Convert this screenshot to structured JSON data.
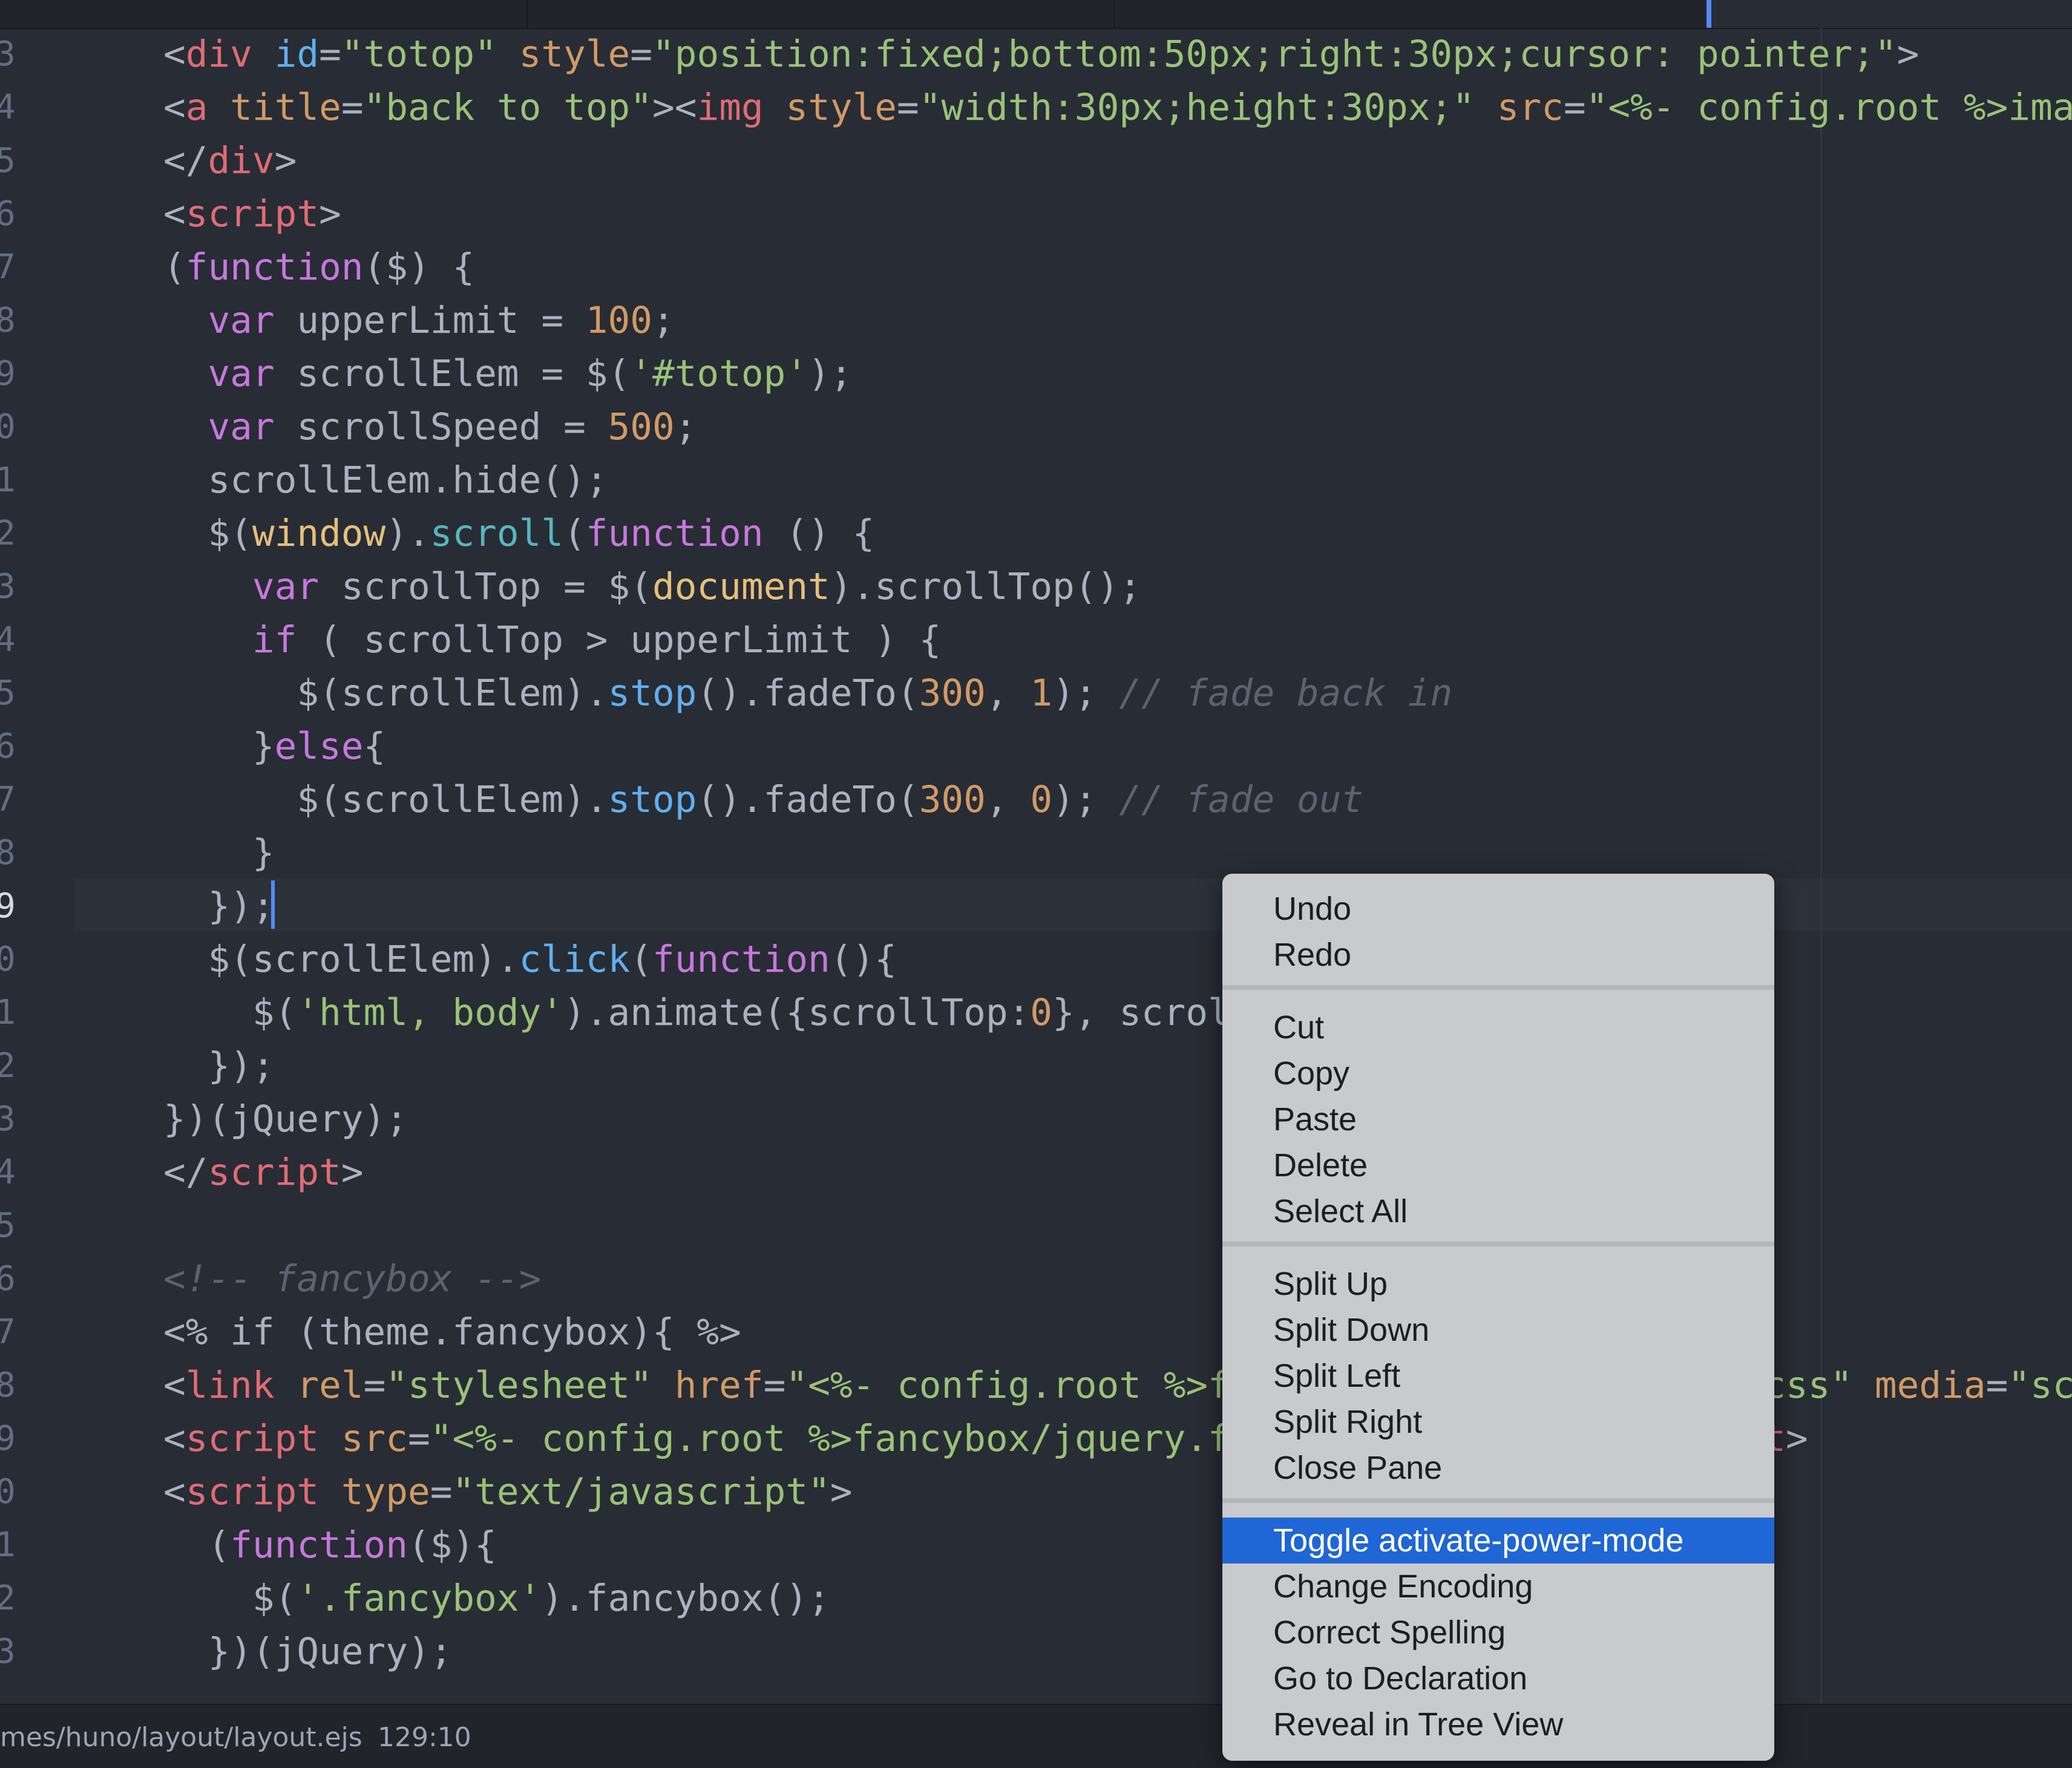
{
  "editor": {
    "lines": [
      {
        "num": "3",
        "segments": [
          {
            "c": "t-p",
            "t": "<"
          },
          {
            "c": "t-tag",
            "t": "div"
          },
          {
            "c": "t-p",
            "t": " "
          },
          {
            "c": "t-fn",
            "t": "id"
          },
          {
            "c": "t-p",
            "t": "="
          },
          {
            "c": "t-str",
            "t": "\"totop\""
          },
          {
            "c": "t-p",
            "t": " "
          },
          {
            "c": "t-attr",
            "t": "style"
          },
          {
            "c": "t-p",
            "t": "="
          },
          {
            "c": "t-str",
            "t": "\"position:fixed;bottom:50px;right:30px;cursor: pointer;\""
          },
          {
            "c": "t-p",
            "t": ">"
          }
        ]
      },
      {
        "num": "4",
        "segments": [
          {
            "c": "t-p",
            "t": "<"
          },
          {
            "c": "t-tag",
            "t": "a"
          },
          {
            "c": "t-p",
            "t": " "
          },
          {
            "c": "t-attr",
            "t": "title"
          },
          {
            "c": "t-p",
            "t": "="
          },
          {
            "c": "t-str",
            "t": "\"back to top\""
          },
          {
            "c": "t-p",
            "t": "><"
          },
          {
            "c": "t-tag",
            "t": "img"
          },
          {
            "c": "t-p",
            "t": " "
          },
          {
            "c": "t-attr",
            "t": "style"
          },
          {
            "c": "t-p",
            "t": "="
          },
          {
            "c": "t-str",
            "t": "\"width:30px;height:30px;\""
          },
          {
            "c": "t-p",
            "t": " "
          },
          {
            "c": "t-attr",
            "t": "src"
          },
          {
            "c": "t-p",
            "t": "="
          },
          {
            "c": "t-str",
            "t": "\"<%- config.root %>image"
          }
        ]
      },
      {
        "num": "5",
        "segments": [
          {
            "c": "t-p",
            "t": "</"
          },
          {
            "c": "t-tag",
            "t": "div"
          },
          {
            "c": "t-p",
            "t": ">"
          }
        ]
      },
      {
        "num": "6",
        "segments": [
          {
            "c": "t-p",
            "t": "<"
          },
          {
            "c": "t-tag",
            "t": "script"
          },
          {
            "c": "t-p",
            "t": ">"
          }
        ]
      },
      {
        "num": "7",
        "segments": [
          {
            "c": "t-p",
            "t": "("
          },
          {
            "c": "t-kw",
            "t": "function"
          },
          {
            "c": "t-p",
            "t": "($) {"
          }
        ]
      },
      {
        "num": "8",
        "segments": [
          {
            "c": "t-p",
            "t": "  "
          },
          {
            "c": "t-kw",
            "t": "var"
          },
          {
            "c": "t-p",
            "t": " upperLimit = "
          },
          {
            "c": "t-num",
            "t": "100"
          },
          {
            "c": "t-p",
            "t": ";"
          }
        ]
      },
      {
        "num": "9",
        "segments": [
          {
            "c": "t-p",
            "t": "  "
          },
          {
            "c": "t-kw",
            "t": "var"
          },
          {
            "c": "t-p",
            "t": " scrollElem = $("
          },
          {
            "c": "t-str",
            "t": "'#totop'"
          },
          {
            "c": "t-p",
            "t": ");"
          }
        ]
      },
      {
        "num": "0",
        "segments": [
          {
            "c": "t-p",
            "t": "  "
          },
          {
            "c": "t-kw",
            "t": "var"
          },
          {
            "c": "t-p",
            "t": " scrollSpeed = "
          },
          {
            "c": "t-num",
            "t": "500"
          },
          {
            "c": "t-p",
            "t": ";"
          }
        ]
      },
      {
        "num": "1",
        "segments": [
          {
            "c": "t-p",
            "t": "  scrollElem.hide();"
          }
        ]
      },
      {
        "num": "2",
        "segments": [
          {
            "c": "t-p",
            "t": "  $("
          },
          {
            "c": "t-glob",
            "t": "window"
          },
          {
            "c": "t-p",
            "t": ")."
          },
          {
            "c": "t-sup",
            "t": "scroll"
          },
          {
            "c": "t-p",
            "t": "("
          },
          {
            "c": "t-kw",
            "t": "function"
          },
          {
            "c": "t-p",
            "t": " () {"
          }
        ]
      },
      {
        "num": "3",
        "segments": [
          {
            "c": "t-p",
            "t": "    "
          },
          {
            "c": "t-kw",
            "t": "var"
          },
          {
            "c": "t-p",
            "t": " scrollTop = $("
          },
          {
            "c": "t-glob",
            "t": "document"
          },
          {
            "c": "t-p",
            "t": ").scrollTop();"
          }
        ]
      },
      {
        "num": "4",
        "segments": [
          {
            "c": "t-p",
            "t": "    "
          },
          {
            "c": "t-kw",
            "t": "if"
          },
          {
            "c": "t-p",
            "t": " ( scrollTop > upperLimit ) {"
          }
        ]
      },
      {
        "num": "5",
        "segments": [
          {
            "c": "t-p",
            "t": "      $(scrollElem)."
          },
          {
            "c": "t-fn",
            "t": "stop"
          },
          {
            "c": "t-p",
            "t": "().fadeTo("
          },
          {
            "c": "t-num",
            "t": "300"
          },
          {
            "c": "t-p",
            "t": ", "
          },
          {
            "c": "t-num",
            "t": "1"
          },
          {
            "c": "t-p",
            "t": "); "
          },
          {
            "c": "t-cm",
            "t": "// fade back in"
          }
        ]
      },
      {
        "num": "6",
        "segments": [
          {
            "c": "t-p",
            "t": "    }"
          },
          {
            "c": "t-kw",
            "t": "else"
          },
          {
            "c": "t-p",
            "t": "{"
          }
        ]
      },
      {
        "num": "7",
        "segments": [
          {
            "c": "t-p",
            "t": "      $(scrollElem)."
          },
          {
            "c": "t-fn",
            "t": "stop"
          },
          {
            "c": "t-p",
            "t": "().fadeTo("
          },
          {
            "c": "t-num",
            "t": "300"
          },
          {
            "c": "t-p",
            "t": ", "
          },
          {
            "c": "t-num",
            "t": "0"
          },
          {
            "c": "t-p",
            "t": "); "
          },
          {
            "c": "t-cm",
            "t": "// fade out"
          }
        ]
      },
      {
        "num": "8",
        "segments": [
          {
            "c": "t-p",
            "t": "    }"
          }
        ]
      },
      {
        "num": "9",
        "active": true,
        "segments": [
          {
            "c": "t-p",
            "t": "  });"
          }
        ]
      },
      {
        "num": "0",
        "segments": [
          {
            "c": "t-p",
            "t": "  $(scrollElem)."
          },
          {
            "c": "t-fn",
            "t": "click"
          },
          {
            "c": "t-p",
            "t": "("
          },
          {
            "c": "t-kw",
            "t": "function"
          },
          {
            "c": "t-p",
            "t": "(){"
          }
        ]
      },
      {
        "num": "1",
        "segments": [
          {
            "c": "t-p",
            "t": "    $("
          },
          {
            "c": "t-str",
            "t": "'html, body'"
          },
          {
            "c": "t-p",
            "t": ").animate({scrollTop:"
          },
          {
            "c": "t-num",
            "t": "0"
          },
          {
            "c": "t-p",
            "t": "}, scroll"
          }
        ]
      },
      {
        "num": "2",
        "segments": [
          {
            "c": "t-p",
            "t": "  });"
          }
        ]
      },
      {
        "num": "3",
        "segments": [
          {
            "c": "t-p",
            "t": "})(jQuery);"
          }
        ]
      },
      {
        "num": "4",
        "segments": [
          {
            "c": "t-p",
            "t": "</"
          },
          {
            "c": "t-tag",
            "t": "script"
          },
          {
            "c": "t-p",
            "t": ">"
          }
        ]
      },
      {
        "num": "5",
        "segments": []
      },
      {
        "num": "6",
        "segments": [
          {
            "c": "t-cm",
            "t": "<!-- fancybox -->"
          }
        ]
      },
      {
        "num": "7",
        "segments": [
          {
            "c": "t-p",
            "t": "<% if (theme.fancybox){ %>"
          }
        ]
      },
      {
        "num": "8",
        "segments": [
          {
            "c": "t-p",
            "t": "<"
          },
          {
            "c": "t-tag",
            "t": "link"
          },
          {
            "c": "t-p",
            "t": " "
          },
          {
            "c": "t-attr",
            "t": "rel"
          },
          {
            "c": "t-p",
            "t": "="
          },
          {
            "c": "t-str",
            "t": "\"stylesheet\""
          },
          {
            "c": "t-p",
            "t": " "
          },
          {
            "c": "t-attr",
            "t": "href"
          },
          {
            "c": "t-p",
            "t": "="
          },
          {
            "c": "t-str",
            "t": "\"<%- config.root %>fancybox/jquery.fancybox.css\""
          },
          {
            "c": "t-p",
            "t": " "
          },
          {
            "c": "t-attr",
            "t": "media"
          },
          {
            "c": "t-p",
            "t": "="
          },
          {
            "c": "t-str",
            "t": "\"scre"
          }
        ]
      },
      {
        "num": "9",
        "segments": [
          {
            "c": "t-p",
            "t": "<"
          },
          {
            "c": "t-tag",
            "t": "script"
          },
          {
            "c": "t-p",
            "t": " "
          },
          {
            "c": "t-attr",
            "t": "src"
          },
          {
            "c": "t-p",
            "t": "="
          },
          {
            "c": "t-str",
            "t": "\"<%- config.root %>fancybox/jquery.fancybox.pack.js\""
          },
          {
            "c": "t-p",
            "t": "></"
          },
          {
            "c": "t-tag",
            "t": "script"
          },
          {
            "c": "t-p",
            "t": ">"
          }
        ]
      },
      {
        "num": "0",
        "segments": [
          {
            "c": "t-p",
            "t": "<"
          },
          {
            "c": "t-tag",
            "t": "script"
          },
          {
            "c": "t-p",
            "t": " "
          },
          {
            "c": "t-attr",
            "t": "type"
          },
          {
            "c": "t-p",
            "t": "="
          },
          {
            "c": "t-str",
            "t": "\"text/javascript\""
          },
          {
            "c": "t-p",
            "t": ">"
          }
        ]
      },
      {
        "num": "1",
        "segments": [
          {
            "c": "t-p",
            "t": "  ("
          },
          {
            "c": "t-kw",
            "t": "function"
          },
          {
            "c": "t-p",
            "t": "($){"
          }
        ]
      },
      {
        "num": "2",
        "segments": [
          {
            "c": "t-p",
            "t": "    $("
          },
          {
            "c": "t-str",
            "t": "'.fancybox'"
          },
          {
            "c": "t-p",
            "t": ").fancybox();"
          }
        ]
      },
      {
        "num": "3",
        "segments": [
          {
            "c": "t-p",
            "t": "  })(jQuery);"
          }
        ]
      }
    ]
  },
  "statusbar": {
    "path": "mes/huno/layout/layout.ejs",
    "position": "129:10"
  },
  "context_menu": {
    "groups": [
      [
        "Undo",
        "Redo"
      ],
      [
        "Cut",
        "Copy",
        "Paste",
        "Delete",
        "Select All"
      ],
      [
        "Split Up",
        "Split Down",
        "Split Left",
        "Split Right",
        "Close Pane"
      ],
      [
        "Toggle activate-power-mode",
        "Change Encoding",
        "Correct Spelling",
        "Go to Declaration",
        "Reveal in Tree View"
      ]
    ],
    "highlighted": "Toggle activate-power-mode"
  }
}
